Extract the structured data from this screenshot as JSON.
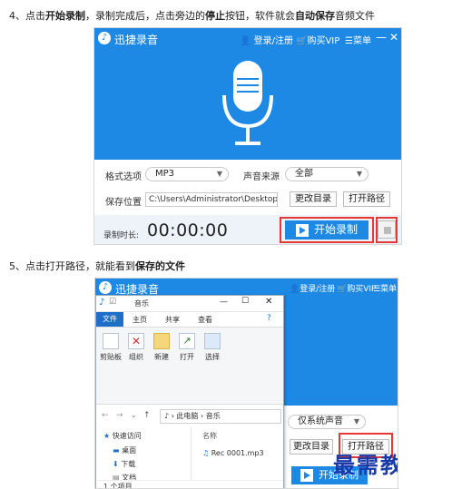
{
  "step4": {
    "prefix": "4、点击",
    "bold1": "开始录制",
    "mid1": "，录制完成后，点击旁边的",
    "bold2": "停止",
    "mid2": "按钮，软件就会",
    "bold3": "自动保存",
    "suffix": "音频文件"
  },
  "step5": {
    "prefix": "5、点击打开路径，就能看到",
    "bold": "保存的文件"
  },
  "app": {
    "title": "迅捷录音",
    "login": "登录/注册",
    "vip": "购买VIP",
    "menu": "菜单",
    "format_label": "格式选项",
    "format_value": "MP3",
    "source_label": "声音来源",
    "source_value": "全部",
    "path_label": "保存位置",
    "path_value": "C:\\Users\\Administrator\\Desktop",
    "change_dir": "更改目录",
    "open_path": "打开路径",
    "timer_label": "录制时长:",
    "timer_value": "00:00:00",
    "start": "开始录制"
  },
  "app2": {
    "title": "迅捷录音",
    "login": "登录/注册",
    "vip": "购买VIP",
    "menu": "菜单",
    "source_value": "仅系统声音",
    "change_dir": "更改目录",
    "open_path": "打开路径",
    "start": "开始录制"
  },
  "explorer": {
    "title": "音乐",
    "tab_file": "文件",
    "tab_home": "主页",
    "tab_share": "共享",
    "tab_view": "查看",
    "ribbon": [
      {
        "label": "剪贴板",
        "icon": "clipboard-icon"
      },
      {
        "label": "组织",
        "icon": "delete-icon"
      },
      {
        "label": "新建",
        "icon": "new-folder-icon"
      },
      {
        "label": "打开",
        "icon": "open-icon"
      },
      {
        "label": "选择",
        "icon": "select-icon"
      }
    ],
    "path_pc": "此电脑",
    "path_music": "音乐",
    "column_name": "名称",
    "file_name": "Rec 0001.mp3",
    "nav": [
      "快速访问",
      "桌面",
      "下载",
      "文档"
    ],
    "status": "1 个项目"
  },
  "watermark": "最需教育",
  "colors": {
    "brand_blue": "#1e88e5",
    "highlight_red": "#e53935"
  }
}
